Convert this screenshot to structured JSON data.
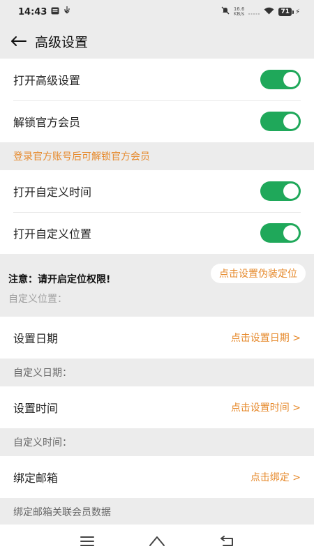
{
  "status_bar": {
    "time": "14:43",
    "net_speed_value": "16.6",
    "net_speed_unit": "KB/s",
    "battery": "71"
  },
  "header": {
    "title": "高级设置"
  },
  "toggles_top": [
    {
      "label": "打开高级设置",
      "on": true
    },
    {
      "label": "解锁官方会员",
      "on": true
    }
  ],
  "notice": "登录官方账号后可解锁官方会员",
  "toggles_mid": [
    {
      "label": "打开自定义时间",
      "on": true
    },
    {
      "label": "打开自定义位置",
      "on": true
    }
  ],
  "location_warning": {
    "warning": "注意：请开启定位权限!",
    "button": "点击设置伪装定位",
    "sub": "自定义位置："
  },
  "date_row": {
    "label": "设置日期",
    "action": "点击设置日期 >"
  },
  "date_sub": "自定义日期：",
  "time_row": {
    "label": "设置时间",
    "action": "点击设置时间 >"
  },
  "time_sub": "自定义时间：",
  "email_row": {
    "label": "绑定邮箱",
    "action": "点击绑定 >"
  },
  "email_sub": "绑定邮箱关联会员数据",
  "colors": {
    "accent_green": "#1fa85a",
    "accent_orange": "#e6892b"
  }
}
